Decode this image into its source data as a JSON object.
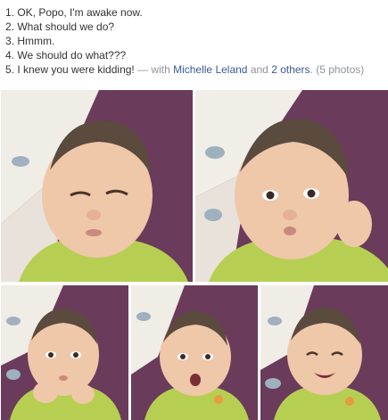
{
  "post": {
    "lines": [
      "1. OK, Popo, I'm awake now.",
      "2. What should we do?",
      "3. Hmmm.",
      "4. We should do what???",
      "5. I knew you were kidding!"
    ],
    "with_prefix": " — with ",
    "tagged_person": "Michelle Leland",
    "and_text": " and ",
    "others_link": "2 others",
    "period": ".",
    "photo_count": "(5 photos)"
  },
  "colors": {
    "link": "#3b5998",
    "muted": "#90949c",
    "text": "#333333",
    "shirt": "#b6cf52",
    "background_purple": "#6a3b5a"
  },
  "photos": [
    {
      "index": 1
    },
    {
      "index": 2
    },
    {
      "index": 3
    },
    {
      "index": 4
    },
    {
      "index": 5
    }
  ]
}
